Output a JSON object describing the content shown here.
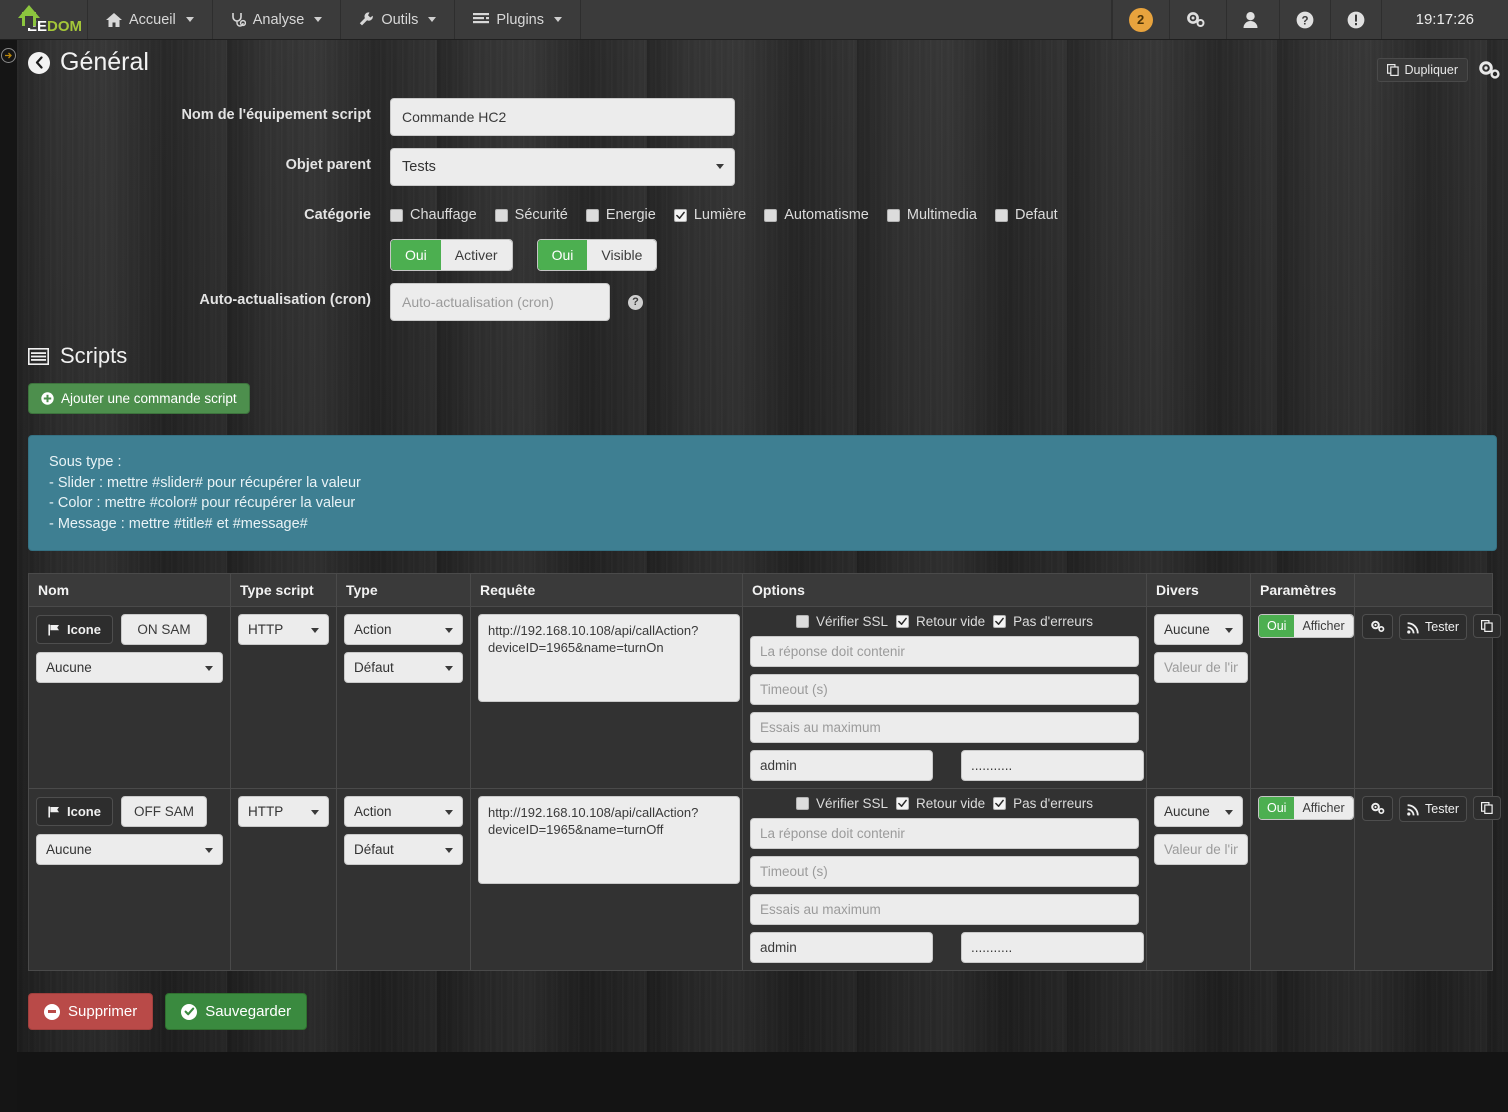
{
  "navbar": {
    "brand": {
      "prefix": "EE",
      "suffix": "DOM"
    },
    "items": [
      {
        "label": "Accueil",
        "icon": "home-icon"
      },
      {
        "label": "Analyse",
        "icon": "stethoscope-icon"
      },
      {
        "label": "Outils",
        "icon": "wrench-icon"
      },
      {
        "label": "Plugins",
        "icon": "list-icon"
      }
    ],
    "badge_count": "2",
    "right_icons": [
      "gears-icon",
      "user-icon",
      "help-icon",
      "alert-icon"
    ],
    "clock": "19:17:26"
  },
  "header": {
    "title": "Général",
    "duplicate_label": "Dupliquer",
    "config_icon": "gears-icon"
  },
  "form": {
    "name_label": "Nom de l'équipement script",
    "name_value": "Commande HC2",
    "parent_label": "Objet parent",
    "parent_value": "Tests",
    "category_label": "Catégorie",
    "categories": [
      {
        "label": "Chauffage",
        "checked": false
      },
      {
        "label": "Sécurité",
        "checked": false
      },
      {
        "label": "Energie",
        "checked": false
      },
      {
        "label": "Lumière",
        "checked": true
      },
      {
        "label": "Automatisme",
        "checked": false
      },
      {
        "label": "Multimedia",
        "checked": false
      },
      {
        "label": "Defaut",
        "checked": false
      }
    ],
    "toggles": [
      {
        "on_label": "Oui",
        "off_label": "Activer"
      },
      {
        "on_label": "Oui",
        "off_label": "Visible"
      }
    ],
    "cron_label": "Auto-actualisation (cron)",
    "cron_placeholder": "Auto-actualisation (cron)",
    "cron_value": "",
    "help_glyph": "?"
  },
  "scripts": {
    "section_title": "Scripts",
    "add_button": "Ajouter une commande script",
    "info": {
      "line1": "Sous type :",
      "line2": "- Slider : mettre #slider# pour récupérer la valeur",
      "line3": "- Color : mettre #color# pour récupérer la valeur",
      "line4": "- Message : mettre #title# et #message#"
    },
    "columns": {
      "nom": "Nom",
      "type_script": "Type script",
      "type": "Type",
      "requete": "Requête",
      "options": "Options",
      "divers": "Divers",
      "parametres": "Paramètres",
      "actions": ""
    },
    "common": {
      "icone_button": "Icone",
      "option_checks": [
        "Vérifier SSL",
        "Retour vide",
        "Pas d'erreurs"
      ],
      "ph_response": "La réponse doit contenir",
      "ph_timeout": "Timeout (s)",
      "ph_retries": "Essais au maximum",
      "ph_info_value": "Valeur de l'info",
      "tester_label": "Tester",
      "show_on": "Oui",
      "show_off": "Afficher"
    },
    "rows": [
      {
        "icone_label": "Icone",
        "name": "ON SAM",
        "icon_select": "Aucune",
        "type_script": "HTTP",
        "type": "Action",
        "subtype": "Défaut",
        "requete": "http://192.168.10.108/api/callAction?deviceID=1965&name=turnOn",
        "check_ssl": false,
        "check_empty": true,
        "check_noerr": true,
        "response_contains": "",
        "timeout": "",
        "max_retries": "",
        "user": "admin",
        "password": "...........",
        "divers_select": "Aucune",
        "divers_value": "",
        "show_on": "Oui",
        "show_off": "Afficher",
        "tester_label": "Tester"
      },
      {
        "icone_label": "Icone",
        "name": "OFF SAM",
        "icon_select": "Aucune",
        "type_script": "HTTP",
        "type": "Action",
        "subtype": "Défaut",
        "requete": "http://192.168.10.108/api/callAction?deviceID=1965&name=turnOff",
        "check_ssl": false,
        "check_empty": true,
        "check_noerr": true,
        "response_contains": "",
        "timeout": "",
        "max_retries": "",
        "user": "admin",
        "password": "...........",
        "divers_select": "Aucune",
        "divers_value": "",
        "show_on": "Oui",
        "show_off": "Afficher",
        "tester_label": "Tester"
      }
    ]
  },
  "footer": {
    "delete_label": "Supprimer",
    "save_label": "Sauvegarder"
  },
  "colors": {
    "green": "#4caf50",
    "red": "#b94a48",
    "info_blue": "#3e7f92",
    "badge_orange": "#e8a33d",
    "brand_green": "#8cc63e"
  }
}
